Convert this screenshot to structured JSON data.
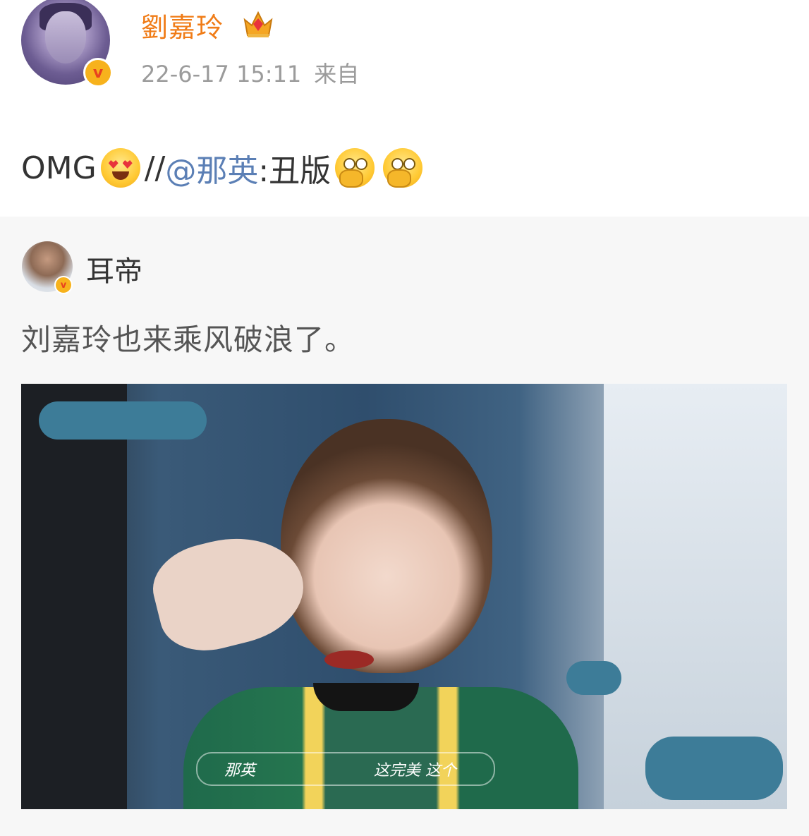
{
  "post": {
    "username": "劉嘉玲",
    "timestamp": "22-6-17 15:11",
    "source_prefix": "来自",
    "text_start": "OMG",
    "text_sep": "//",
    "mention": "@那英",
    "text_after_mention": ":丑版",
    "icons": [
      "heart-eyes-emoji",
      "thinking-emoji",
      "crown-icon",
      "verified-badge-icon"
    ]
  },
  "repost": {
    "username": "耳帝",
    "text": "刘嘉玲也来乘风破浪了。",
    "image": {
      "caption_left": "那英",
      "caption_right": "这完美 这个"
    }
  },
  "badge": {
    "verified_label": "v"
  },
  "colors": {
    "username": "#f07c17",
    "mention": "#5b7fb5",
    "repost_bg": "#f7f7f7",
    "censor": "#3d7c98"
  }
}
